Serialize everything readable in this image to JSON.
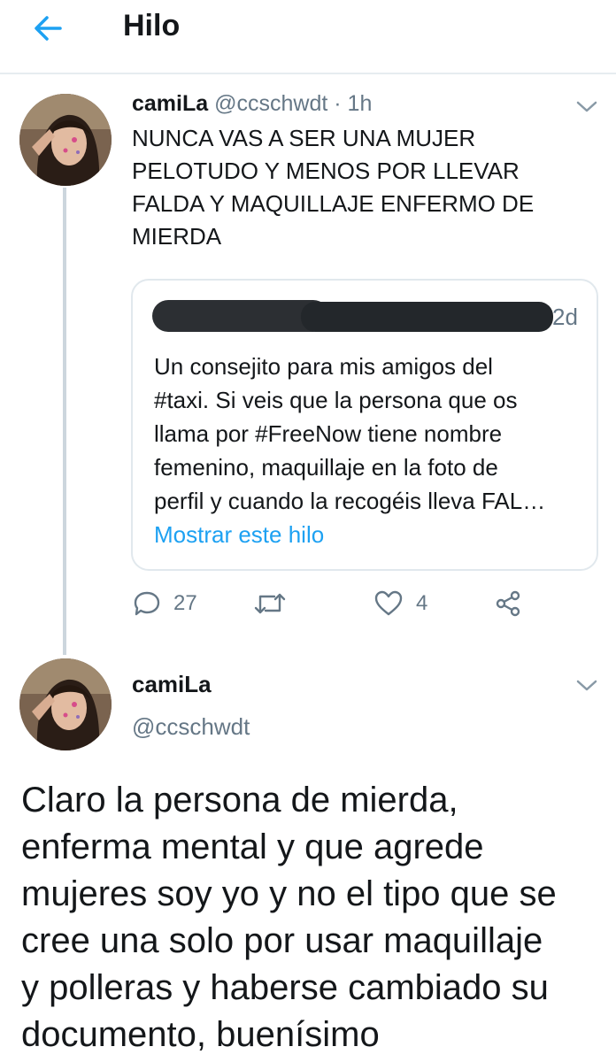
{
  "header": {
    "title": "Hilo"
  },
  "tweet1": {
    "display_name": "camiLa",
    "handle": "@ccschwdt",
    "separator": "·",
    "time": "1h",
    "text": "NUNCA VAS A SER UNA MUJER\nPELOTUDO Y MENOS POR LLEVAR\nFALDA Y MAQUILLAJE ENFERMO DE\nMIERDA",
    "quote": {
      "time": "2d",
      "text": "Un consejito para mis amigos del\n#taxi. Si veis que la persona que os\nllama por #FreeNow tiene nombre\nfemenino, maquillaje en la foto de\nperfil y cuando la recogéis lleva FAL…",
      "show_thread": "Mostrar este hilo"
    },
    "actions": {
      "replies": "27",
      "likes": "4"
    }
  },
  "tweet2": {
    "display_name": "camiLa",
    "handle": "@ccschwdt",
    "text": "Claro la persona de mierda,\nenferma mental y que agrede\nmujeres soy yo y no el tipo que se\ncree una solo por usar maquillaje\ny polleras y haberse cambiado su\ndocumento, buenísimo"
  },
  "icons": {
    "back": "arrow-left-icon",
    "menu": "chevron-down-icon",
    "reply": "reply-icon",
    "retweet": "retweet-icon",
    "like": "heart-icon",
    "share": "share-icon"
  },
  "colors": {
    "accent": "#1da1f2",
    "text": "#14171a",
    "secondary": "#657786",
    "divider": "#e6ecf0"
  }
}
